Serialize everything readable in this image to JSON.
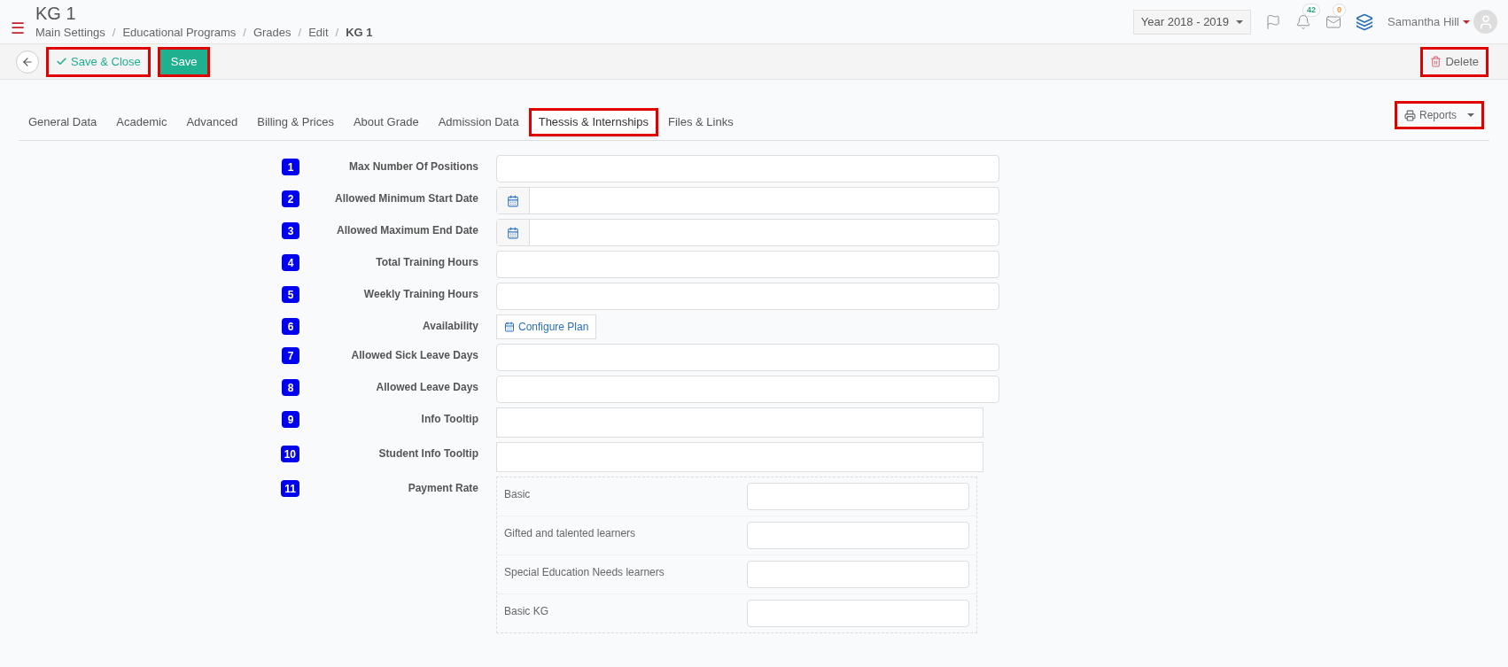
{
  "header": {
    "title": "KG 1",
    "breadcrumbs": [
      "Main Settings",
      "Educational Programs",
      "Grades",
      "Edit",
      "KG 1"
    ],
    "breadcrumb_separator": "/",
    "menu_glyph": "☰",
    "year_selector": "Year 2018 - 2019",
    "notifications_count": "42",
    "messages_count": "0",
    "user_name": "Samantha Hill"
  },
  "toolbar": {
    "buttons": [
      {
        "label": "Save & Close",
        "kind": "outline",
        "highlighted": true
      },
      {
        "label": "Save",
        "kind": "primary",
        "highlighted": true
      }
    ],
    "delete": {
      "label": "Delete",
      "highlighted": true
    }
  },
  "tabs": [
    {
      "label": "General Data",
      "selected": false,
      "highlighted": false
    },
    {
      "label": "Academic",
      "selected": false,
      "highlighted": false
    },
    {
      "label": "Advanced",
      "selected": false,
      "highlighted": false
    },
    {
      "label": "Billing & Prices",
      "selected": false,
      "highlighted": false
    },
    {
      "label": "About Grade",
      "selected": false,
      "highlighted": false
    },
    {
      "label": "Admission Data",
      "selected": false,
      "highlighted": false
    },
    {
      "label": "Thessis & Internships",
      "selected": true,
      "highlighted": true
    },
    {
      "label": "Files & Links",
      "selected": false,
      "highlighted": false
    }
  ],
  "reports": {
    "label": "Reports",
    "highlighted": true
  },
  "fields": [
    {
      "number": "1",
      "label": "Max Number Of Positions",
      "kind": "text"
    },
    {
      "number": "2",
      "label": "Allowed Minimum Start Date",
      "kind": "date"
    },
    {
      "number": "3",
      "label": "Allowed Maximum End Date",
      "kind": "date"
    },
    {
      "number": "4",
      "label": "Total Training Hours",
      "kind": "text"
    },
    {
      "number": "5",
      "label": "Weekly Training Hours",
      "kind": "text"
    },
    {
      "number": "6",
      "label": "Availability",
      "kind": "button",
      "button_label": "Configure Plan"
    },
    {
      "number": "7",
      "label": "Allowed Sick Leave Days",
      "kind": "text"
    },
    {
      "number": "8",
      "label": "Allowed Leave Days",
      "kind": "text"
    },
    {
      "number": "9",
      "label": "Info Tooltip",
      "kind": "textarea"
    },
    {
      "number": "10",
      "label": "Student Info Tooltip",
      "kind": "textarea"
    },
    {
      "number": "11",
      "label": "Payment Rate",
      "kind": "rates",
      "rows": [
        "Basic",
        "Gifted and talented learners",
        "Special Education Needs learners",
        "Basic KG"
      ]
    }
  ]
}
